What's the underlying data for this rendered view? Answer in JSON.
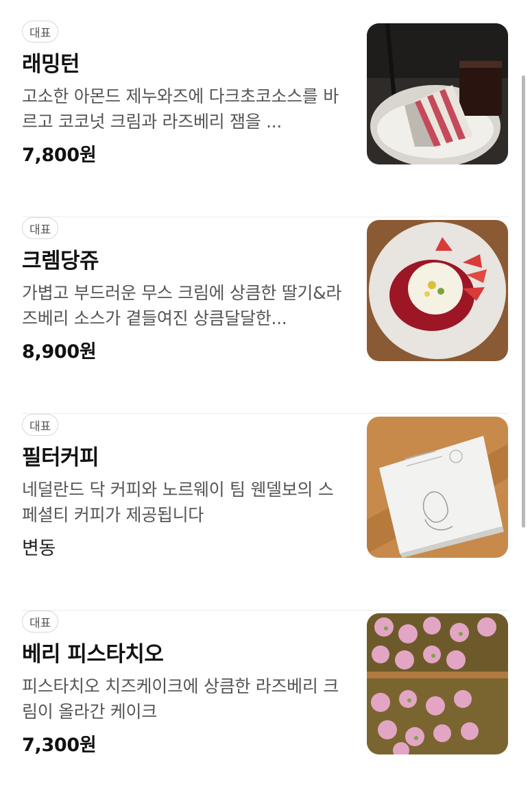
{
  "menu": {
    "items": [
      {
        "badge": "대표",
        "name": "래밍턴",
        "description": "고소한 아몬드 제누와즈에 다크초코소스를 바르고 코코넛 크림과 라즈베리 잼을 ...",
        "price": "7,800원",
        "image": "layer-cake-photo"
      },
      {
        "badge": "대표",
        "name": "크렘당쥬",
        "description": "가볍고 부드러운 무스 크림에 상큼한 딸기&라즈베리 소스가 곁들여진 상큼달달한...",
        "price": "8,900원",
        "image": "mousse-dessert-photo"
      },
      {
        "badge": "대표",
        "name": "필터커피",
        "description": "네덜란드 닥 커피와 노르웨이 팀 웬델보의 스페셜티 커피가 제공됩니다",
        "price": "변동",
        "image": "coffee-package-photo"
      },
      {
        "badge": "대표",
        "name": "베리 피스타치오",
        "description": "피스타치오 치즈케이크에 상큼한 라즈베리 크림이 올라간 케이크",
        "price": "7,300원",
        "image": "pistachio-cake-photo"
      }
    ]
  }
}
